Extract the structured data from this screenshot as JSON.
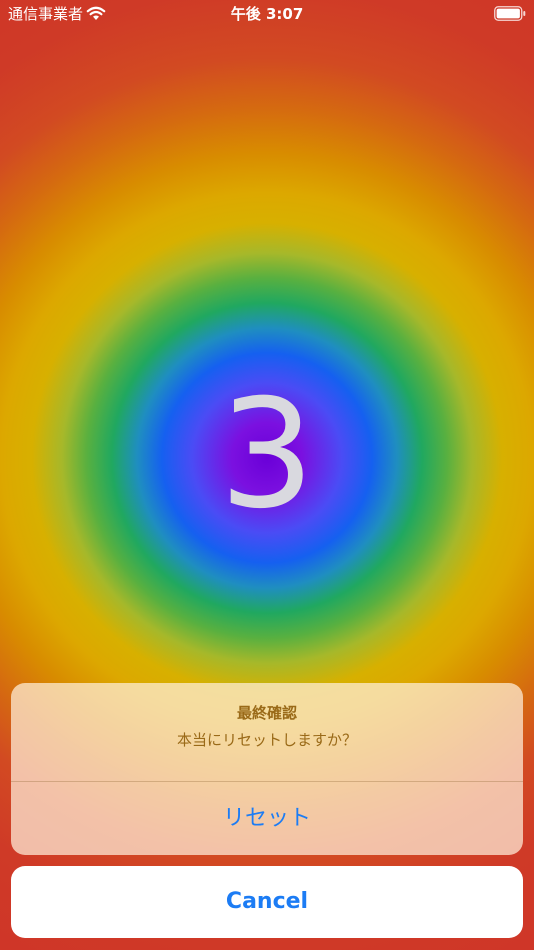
{
  "status_bar": {
    "carrier": "通信事業者",
    "wifi_icon": "wifi-icon",
    "time": "午後 3:07",
    "battery_icon": "battery-icon"
  },
  "counter": {
    "value": "3"
  },
  "action_sheet": {
    "title": "最終確認",
    "message": "本当にリセットしますか？",
    "reset_label": "リセット",
    "cancel_label": "Cancel"
  },
  "colors": {
    "accent": "#1c7cf4",
    "sheet_text": "#9a6a18",
    "counter_text": "#d9d9df"
  }
}
